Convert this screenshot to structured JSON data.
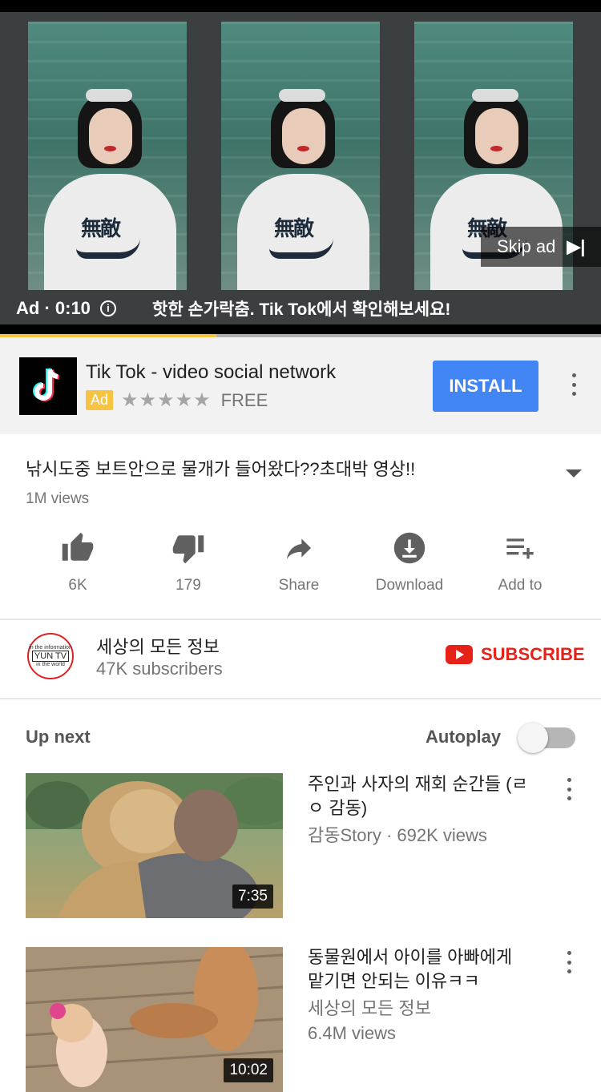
{
  "player": {
    "skip_ad_label": "Skip ad",
    "skip_icon": "skip-next-icon",
    "ad_timer": "Ad · 0:10",
    "info_icon": "info-icon",
    "ad_caption": "핫한 손가락춤. Tik Tok에서 확인해보세요!",
    "logo_mark": "無敵",
    "progress": 0.36,
    "progress_color": "#f6c342"
  },
  "ad_card": {
    "app_name": "Tik Tok - video social network",
    "badge": "Ad",
    "stars": "★★★★★",
    "price": "FREE",
    "install_label": "INSTALL",
    "install_color": "#4285f4"
  },
  "video": {
    "title": "낚시도중 보트안으로 물개가 들어왔다??초대박 영상!!",
    "views": "1M views",
    "actions": [
      {
        "label": "6K",
        "icon": "thumbs-up-icon"
      },
      {
        "label": "179",
        "icon": "thumbs-down-icon"
      },
      {
        "label": "Share",
        "icon": "share-icon"
      },
      {
        "label": "Download",
        "icon": "download-icon"
      },
      {
        "label": "Add to",
        "icon": "playlist-add-icon"
      }
    ]
  },
  "channel": {
    "avatar_line1": "in the information",
    "avatar_line2": "YUN TV",
    "avatar_line3": "in the world",
    "name": "세상의 모든 정보",
    "subscribers": "47K subscribers",
    "subscribe_label": "SUBSCRIBE",
    "subscribe_color": "#e62117"
  },
  "up_next": {
    "label": "Up next",
    "autoplay_label": "Autoplay",
    "autoplay_on": false,
    "items": [
      {
        "title": "주인과 사자의 재회 순간들 (ㄹㅇ 감동)",
        "channel_views": "감동Story · 692K views",
        "duration": "7:35"
      },
      {
        "title": "동물원에서 아이를 아빠에게 맡기면 안되는 이유ㅋㅋ",
        "channel": "세상의 모든 정보",
        "views": "6.4M views",
        "duration": "10:02"
      }
    ]
  }
}
